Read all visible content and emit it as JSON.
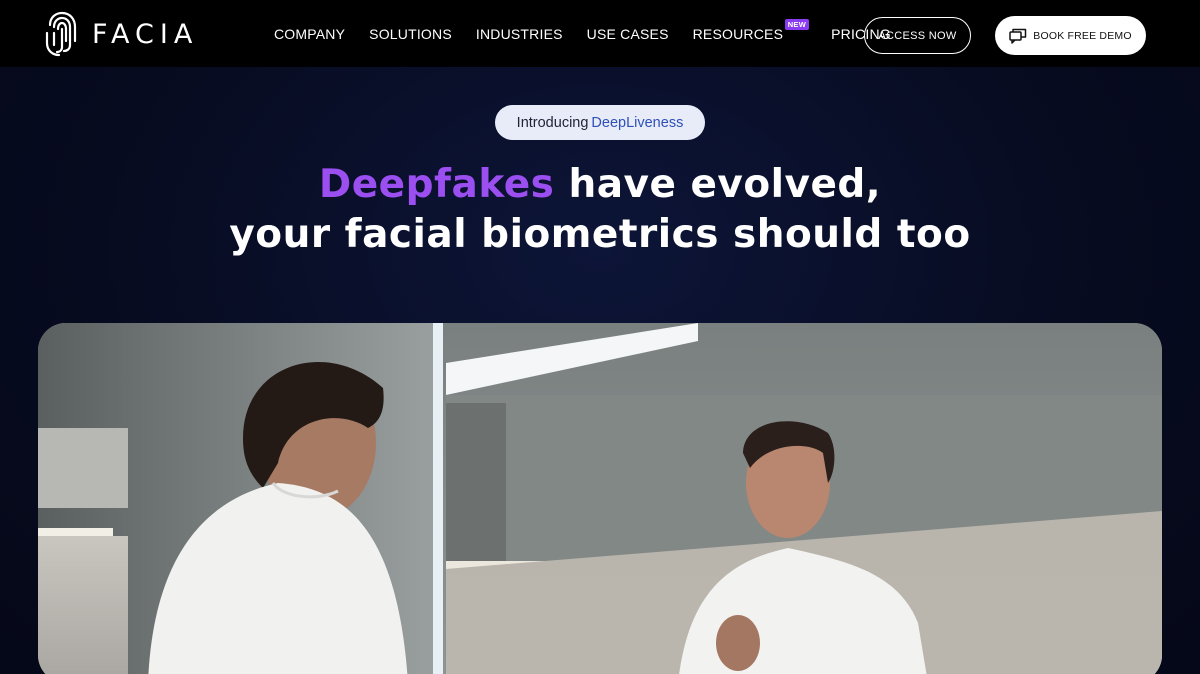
{
  "brand": {
    "name": "FACIA"
  },
  "nav": {
    "items": [
      {
        "label": "COMPANY"
      },
      {
        "label": "SOLUTIONS"
      },
      {
        "label": "INDUSTRIES"
      },
      {
        "label": "USE CASES"
      },
      {
        "label": "RESOURCES",
        "badge": "NEW"
      },
      {
        "label": "PRICING"
      }
    ],
    "access_label": "ACCESS NOW",
    "demo_label": "BOOK FREE DEMO"
  },
  "hero": {
    "pill_prefix": "Introducing",
    "pill_accent": "DeepLiveness",
    "headline_highlight": "Deepfakes",
    "headline_rest": " have evolved,",
    "headline_line2": "your facial biometrics should too"
  },
  "colors": {
    "accent_purple": "#9b4ff0",
    "pill_accent_blue": "#2e4fb8",
    "nav_background": "#000000",
    "hero_background": "#070b1f"
  },
  "icons": {
    "logo": "fingerprint-icon",
    "demo": "chat-icon"
  }
}
